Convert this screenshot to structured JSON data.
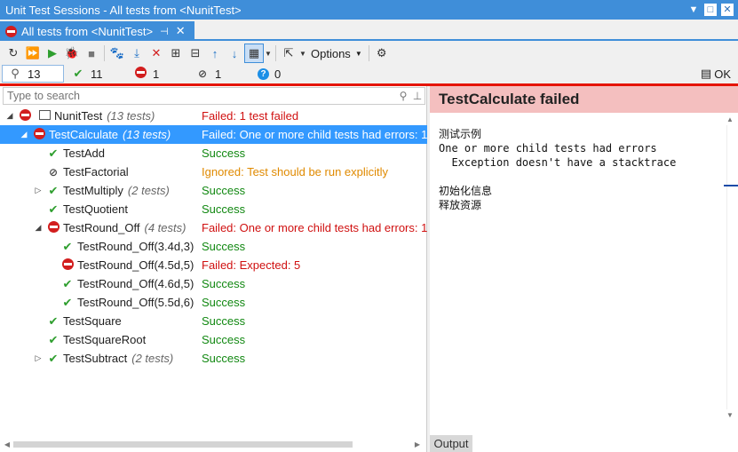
{
  "window": {
    "title": "Unit Test Sessions - All tests from <NunitTest>"
  },
  "tab": {
    "label": "All tests from <NunitTest>",
    "pin": "⊣",
    "close": "✕"
  },
  "toolbar": {
    "options_label": "Options"
  },
  "counters": {
    "all": "13",
    "passed": "11",
    "failed": "1",
    "ignored": "1",
    "inconclusive": "0",
    "ok_label": "OK"
  },
  "search": {
    "placeholder": "Type to search"
  },
  "tree": [
    {
      "name": "NunitTest",
      "count": "(13 tests)",
      "result": "Failed: 1 test failed",
      "status": "failed",
      "level": 0,
      "expander": "expanded",
      "icon": "project"
    },
    {
      "name": "TestCalculate",
      "count": "(13 tests)",
      "result": "Failed: One or more child tests had errors: 1",
      "status": "failed",
      "level": 1,
      "expander": "expanded",
      "icon": "fail",
      "selected": true
    },
    {
      "name": "TestAdd",
      "count": "",
      "result": "Success",
      "status": "success",
      "level": 2,
      "expander": "none",
      "icon": "pass"
    },
    {
      "name": "TestFactorial",
      "count": "",
      "result": "Ignored: Test should be run explicitly",
      "status": "ignored",
      "level": 2,
      "expander": "none",
      "icon": "ignore"
    },
    {
      "name": "TestMultiply",
      "count": "(2 tests)",
      "result": "Success",
      "status": "success",
      "level": 2,
      "expander": "collapsed",
      "icon": "pass"
    },
    {
      "name": "TestQuotient",
      "count": "",
      "result": "Success",
      "status": "success",
      "level": 2,
      "expander": "none",
      "icon": "pass"
    },
    {
      "name": "TestRound_Off",
      "count": "(4 tests)",
      "result": "Failed: One or more child tests had errors: 1",
      "status": "failed",
      "level": 2,
      "expander": "expanded",
      "icon": "fail"
    },
    {
      "name": "TestRound_Off(3.4d,3)",
      "count": "",
      "result": "Success",
      "status": "success",
      "level": 3,
      "expander": "none",
      "icon": "pass"
    },
    {
      "name": "TestRound_Off(4.5d,5)",
      "count": "",
      "result": "Failed:   Expected: 5",
      "status": "failed",
      "level": 3,
      "expander": "none",
      "icon": "fail"
    },
    {
      "name": "TestRound_Off(4.6d,5)",
      "count": "",
      "result": "Success",
      "status": "success",
      "level": 3,
      "expander": "none",
      "icon": "pass"
    },
    {
      "name": "TestRound_Off(5.5d,6)",
      "count": "",
      "result": "Success",
      "status": "success",
      "level": 3,
      "expander": "none",
      "icon": "pass"
    },
    {
      "name": "TestSquare",
      "count": "",
      "result": "Success",
      "status": "success",
      "level": 2,
      "expander": "none",
      "icon": "pass"
    },
    {
      "name": "TestSquareRoot",
      "count": "",
      "result": "Success",
      "status": "success",
      "level": 2,
      "expander": "none",
      "icon": "pass"
    },
    {
      "name": "TestSubtract",
      "count": "(2 tests)",
      "result": "Success",
      "status": "success",
      "level": 2,
      "expander": "collapsed",
      "icon": "pass"
    }
  ],
  "detail": {
    "title": "TestCalculate failed",
    "output": "测试示例\nOne or more child tests had errors\n  Exception doesn't have a stacktrace\n\n初始化信息\n释放资源"
  },
  "bottom": {
    "output_tab": "Output"
  },
  "icons": {
    "refresh": "↻",
    "run_all": "⏩",
    "run": "▶",
    "debug": "🐞",
    "stop": "■",
    "track": "🐾",
    "import": "⤓",
    "remove": "✕",
    "group": "⊞",
    "collapse": "⊟",
    "up": "↑",
    "down": "↓",
    "layout": "▦",
    "export": "⇱",
    "settings": "⚙"
  }
}
